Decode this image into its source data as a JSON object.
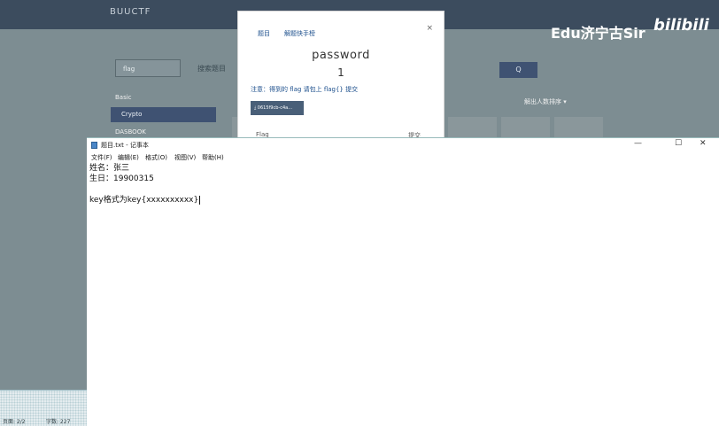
{
  "background_page": {
    "brand": "BUUCTF",
    "search_value": "flag",
    "search_label": "搜索题目",
    "search_button": "Q",
    "categories": [
      "Basic",
      "Crypto",
      "DASBOOK"
    ],
    "sort_label": "解出人数排序 ▾",
    "watermark": "Edu济宁古Sir",
    "watermark_logo": "bilibili"
  },
  "modal": {
    "tab_challenge": "题目",
    "tab_solvers": "解题快手榜",
    "close": "×",
    "title": "password",
    "points": "1",
    "notice": "注意：得到的 flag 请包上 flag{} 提交",
    "file_button": "⤓ 0615f9cb-c4a…",
    "flag_placeholder": "Flag",
    "submit_label": "提交"
  },
  "notepad": {
    "title": "题目.txt - 记事本",
    "menu": [
      "文件(F)",
      "编辑(E)",
      "格式(O)",
      "视图(V)",
      "帮助(H)"
    ],
    "lines": [
      "姓名：张三",
      "生日：19900315",
      "",
      "key格式为key{xxxxxxxxxx}"
    ],
    "minimize": "—",
    "maximize": "☐",
    "close": "✕"
  },
  "statusbar": {
    "page": "页面: 2/2",
    "words": "字数: 227"
  },
  "colors": {
    "nav": "#3c4c5e",
    "accent": "#3f5272",
    "link": "#1c4f8c"
  }
}
